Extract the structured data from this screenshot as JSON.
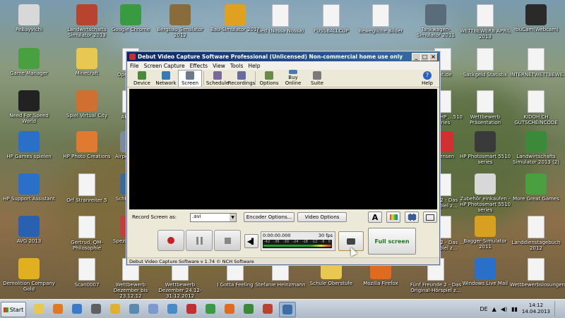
{
  "desktop_icons": [
    {
      "label": "PeBayvichi",
      "color": "#d8d8d8",
      "glyph": "ebay-icon"
    },
    {
      "label": "Landwirtschafts Simulator 2013",
      "color": "#b8432f",
      "glyph": "tractor-icon"
    },
    {
      "label": "Google Chrome",
      "color": "#3a9a42",
      "glyph": "chrome-icon"
    },
    {
      "label": "Bergbau Simulator 2012",
      "color": "#8a6b3a",
      "glyph": "excavator-icon"
    },
    {
      "label": "Bau-Simulator 2012",
      "color": "#e0a020",
      "glyph": "helmet-icon"
    },
    {
      "label": "Lied (Nossa Nossa)",
      "color": "#f4f4f4",
      "glyph": "file-icon"
    },
    {
      "label": "FUSSBALLCUP",
      "color": "#f4f4f4",
      "glyph": "doc-icon"
    },
    {
      "label": "Bewegliche Bilder",
      "color": "#f4f4f4",
      "glyph": "doc-icon"
    },
    {
      "label": "Tankwagen-Simulator 2011",
      "color": "#5a6b7a",
      "glyph": "truck-icon"
    },
    {
      "label": "WETTBEWERB APRIL 2013",
      "color": "#f4f4f4",
      "glyph": "doc-icon"
    },
    {
      "label": "YouCam(Webcam)",
      "color": "#2a2a2a",
      "glyph": "webcam-icon"
    },
    {
      "label": "Game Manager",
      "color": "#4aa040",
      "glyph": "game-manager-icon"
    },
    {
      "label": "Minecraft",
      "color": "#e8c850",
      "glyph": "folder-icon"
    },
    {
      "label": "OpenOffi…",
      "color": "#f4f4f4",
      "glyph": "file-icon"
    },
    {
      "label": "Sackgeld Statistik",
      "color": "#f4f4f4",
      "glyph": "sheet-icon"
    },
    {
      "label": "INTERNETWETTBEWE…",
      "color": "#f4f4f4",
      "glyph": "doc-icon"
    },
    {
      "label": "Need For Speed World",
      "color": "#222222",
      "glyph": "nfs-icon"
    },
    {
      "label": "Spiel Virtual City",
      "color": "#d07030",
      "glyph": "city-icon"
    },
    {
      "label": "AUTO…",
      "color": "#f4f4f4",
      "glyph": "doc-icon"
    },
    {
      "label": "Wettbewerb Präsentation",
      "color": "#f4f4f4",
      "glyph": "doc-icon"
    },
    {
      "label": "KIDOH.CH GUTSCHEINCODE",
      "color": "#f4f4f4",
      "glyph": "doc-icon"
    },
    {
      "label": "HP Games spielen",
      "color": "#2a70c8",
      "glyph": "hp-games-icon"
    },
    {
      "label": "HP Photo Creations",
      "color": "#e07a30",
      "glyph": "photo-icon"
    },
    {
      "label": "AirportTow…",
      "color": "#7a8aa0",
      "glyph": "airport-icon"
    },
    {
      "label": "HP Photosmart 5510 series",
      "color": "#3a3a3a",
      "glyph": "printer-icon"
    },
    {
      "label": "Landwirtschafts Simulator 2013 (2)",
      "color": "#3a8a3a",
      "glyph": "tractor-icon"
    },
    {
      "label": "HP Support Assistant",
      "color": "#2a70c8",
      "glyph": "help-icon"
    },
    {
      "label": "Orf Stranreiter 5",
      "color": "#f4f4f4",
      "glyph": "doc-icon"
    },
    {
      "label": "Schiff-Sim…",
      "color": "#3a6a9a",
      "glyph": "ship-icon"
    },
    {
      "label": "Zubehör einkaufen - HP Photosmart 5510 series",
      "color": "#d8d8d8",
      "glyph": "shop-icon"
    },
    {
      "label": "More Great Games",
      "color": "#4aa040",
      "glyph": "games-icon"
    },
    {
      "label": "AVG 2013",
      "color": "#2a60b0",
      "glyph": "avg-icon"
    },
    {
      "label": "Gertrud, QM-Philosophie",
      "color": "#f4f4f4",
      "glyph": "doc-icon"
    },
    {
      "label": "Spezialfahrz…",
      "color": "#c04040",
      "glyph": "vehicle-icon"
    },
    {
      "label": "Bagger-Simulator 2011",
      "color": "#d8a020",
      "glyph": "excavator-icon"
    },
    {
      "label": "Landdienstagebuch 2012",
      "color": "#f4f4f4",
      "glyph": "doc-icon"
    },
    {
      "label": "Demolition Company Gold",
      "color": "#e0b020",
      "glyph": "demolition-icon"
    },
    {
      "label": "Scan0007",
      "color": "#f4f4f4",
      "glyph": "doc-icon"
    },
    {
      "label": "Wettbewerb Dezember bis 23.12.12",
      "color": "#f4f4f4",
      "glyph": "doc-icon"
    },
    {
      "label": "Wettbewerb Dezember 24.12-31.12.2012",
      "color": "#f4f4f4",
      "glyph": "doc-icon"
    },
    {
      "label": "I Gotta Feeling",
      "color": "#f4f4f4",
      "glyph": "file-icon"
    },
    {
      "label": "Stefanie Heinzmann",
      "color": "#f4f4f4",
      "glyph": "file-icon"
    },
    {
      "label": "Schule Oberstufe",
      "color": "#e8c850",
      "glyph": "folder-icon"
    },
    {
      "label": "Mozilla Firefox",
      "color": "#e06a20",
      "glyph": "firefox-icon"
    },
    {
      "label": "Fünf Freunde 2 - Das Original-Hörspiel z…",
      "color": "#f4f4f4",
      "glyph": "mp3-icon"
    },
    {
      "label": "Windows Live Mail",
      "color": "#2a70c8",
      "glyph": "mail-icon"
    },
    {
      "label": "Wettbewerbslosungen",
      "color": "#f4f4f4",
      "glyph": "doc-icon"
    },
    {
      "label": "…ter - HP …510 series",
      "color": "#f4f4f4",
      "glyph": "doc-icon"
    },
    {
      "label": "…nensen",
      "color": "#d03030",
      "glyph": "pdf-icon"
    },
    {
      "label": "…nt.de",
      "color": "#f4f4f4",
      "glyph": "doc-icon"
    },
    {
      "label": "…ünde 2 - Das …Hörspiel z…",
      "color": "#f4f4f4",
      "glyph": "mp3-icon"
    },
    {
      "label": "…ünde 2 - Das …Hörspiel z…",
      "color": "#f4f4f4",
      "glyph": "mp3-icon"
    }
  ],
  "window": {
    "title": "Debut Video Capture Software Professional (Unlicensed) Non-commercial home use only",
    "menu": [
      "File",
      "Screen Capture",
      "Effects",
      "View",
      "Tools",
      "Help"
    ],
    "toolbar": [
      {
        "label": "Device",
        "icon": "device-icon",
        "color": "#4a8a3a",
        "selected": false
      },
      {
        "label": "Network",
        "icon": "network-icon",
        "color": "#3a7ab0",
        "selected": false
      },
      {
        "label": "Screen",
        "icon": "screen-icon",
        "color": "#6a7a8a",
        "selected": true
      },
      {
        "label": "Schedule",
        "icon": "schedule-icon",
        "color": "#7a6a9a",
        "selected": false
      },
      {
        "label": "Recordings",
        "icon": "recordings-icon",
        "color": "#6a6aa0",
        "selected": false
      },
      {
        "label": "Options",
        "icon": "options-icon",
        "color": "#6a8a4a",
        "selected": false
      },
      {
        "label": "Buy Online",
        "icon": "buy-online-icon",
        "color": "#4a7ab0",
        "selected": false
      },
      {
        "label": "Suite",
        "icon": "suite-icon",
        "color": "#7a7a7a",
        "selected": false
      }
    ],
    "help_label": "Help",
    "record_label": "Record Screen as:",
    "format_value": ".avi",
    "encoder_options": "Encoder Options...",
    "video_options": "Video Options",
    "time": "0:00:00.000",
    "fps": "30 fps",
    "meter_ticks": [
      "-42",
      "-36",
      "-30",
      "-24",
      "-18",
      "-12",
      "-6",
      "0"
    ],
    "fullscreen": "Full screen",
    "status": "Debut Video Capture Software v 1.74 © NCH Software"
  },
  "taskbar": {
    "start": "Start",
    "lang": "DE",
    "time": "14:12",
    "date": "14.04.2013",
    "apps": [
      {
        "name": "explorer-icon",
        "color": "#e8c850"
      },
      {
        "name": "media-player-icon",
        "color": "#e07a20"
      },
      {
        "name": "ie-icon",
        "color": "#3a7ac8"
      },
      {
        "name": "mouse-icon",
        "color": "#606060"
      },
      {
        "name": "app-icon",
        "color": "#e0b030"
      },
      {
        "name": "airplane-icon",
        "color": "#5a8ab0"
      },
      {
        "name": "itunes-icon",
        "color": "#7a9ad0"
      },
      {
        "name": "uploader-icon",
        "color": "#4a8ac8"
      },
      {
        "name": "car-icon",
        "color": "#c03030"
      },
      {
        "name": "chrome-icon",
        "color": "#3a9a42"
      },
      {
        "name": "firefox-icon",
        "color": "#e06a20"
      },
      {
        "name": "tractor-icon",
        "color": "#3a8a3a"
      },
      {
        "name": "tractor-red-icon",
        "color": "#b8432f"
      },
      {
        "name": "debut-icon",
        "color": "#3a6ea5"
      }
    ]
  }
}
